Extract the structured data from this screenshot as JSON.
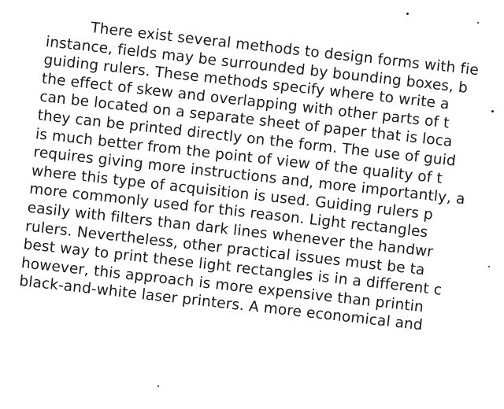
{
  "document": {
    "lines": [
      "There exist several methods to design forms with fie",
      "instance, fields may be surrounded by bounding boxes, b",
      "guiding rulers. These methods specify where to write a",
      "the effect of skew and overlapping with other parts of t",
      "can be located on a separate sheet of paper that is loca",
      "they can be printed directly on the form. The use of guid",
      "is much better from the point of view of the quality of t",
      "requires giving more instructions and, more importantly, a",
      "where this type of acquisition is used. Guiding rulers p",
      "more commonly used for this reason. Light rectangles",
      "easily with filters than dark lines whenever the handwr",
      "rulers. Nevertheless, other practical issues must be ta",
      "best way to print these light rectangles is in a different c",
      "however, this approach is more expensive than printin",
      "black-and-white laser printers. A more economical and"
    ]
  }
}
